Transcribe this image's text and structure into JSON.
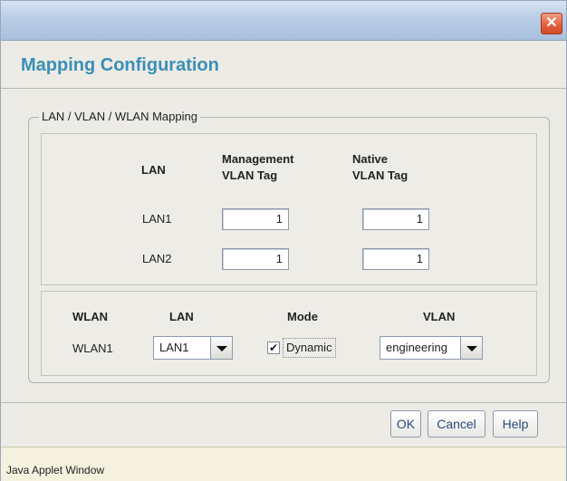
{
  "window": {
    "close_glyph": "✕",
    "heading": "Mapping Configuration"
  },
  "group": {
    "legend": "LAN / VLAN / WLAN Mapping"
  },
  "lan_table": {
    "headers": {
      "lan": "LAN",
      "mgmt_line1": "Management",
      "mgmt_line2": "VLAN Tag",
      "native_line1": "Native",
      "native_line2": "VLAN Tag"
    },
    "rows": [
      {
        "lan": "LAN1",
        "management_vlan_tag": "1",
        "native_vlan_tag": "1"
      },
      {
        "lan": "LAN2",
        "management_vlan_tag": "1",
        "native_vlan_tag": "1"
      }
    ]
  },
  "wlan_table": {
    "headers": {
      "wlan": "WLAN",
      "lan": "LAN",
      "mode": "Mode",
      "vlan": "VLAN"
    },
    "rows": [
      {
        "wlan": "WLAN1",
        "lan": "LAN1",
        "mode_checked": true,
        "mode_label": "Dynamic",
        "vlan": "engineering"
      }
    ]
  },
  "buttons": {
    "ok": "OK",
    "cancel": "Cancel",
    "help": "Help"
  },
  "status_bar": "Java Applet Window",
  "colors": {
    "heading": "#3b8fb6",
    "button_text": "#2a4a7a",
    "close": "#e4603c"
  }
}
